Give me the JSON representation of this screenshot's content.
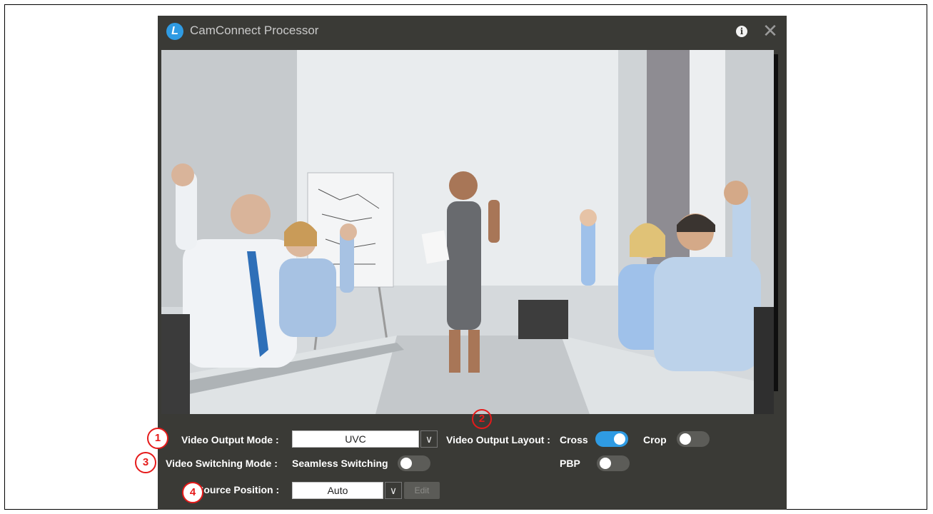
{
  "window": {
    "title": "CamConnect Processor",
    "logo_letter": "L",
    "icons": {
      "info": "info-icon",
      "close": "close-icon",
      "logo": "app-logo-icon"
    }
  },
  "controls": {
    "video_output_mode": {
      "label": "Video Output Mode :",
      "value": "UVC"
    },
    "video_output_layout": {
      "label": "Video Output Layout :",
      "options": [
        {
          "label": "Cross",
          "on": true
        },
        {
          "label": "Crop",
          "on": false
        },
        {
          "label": "PBP",
          "on": false
        }
      ]
    },
    "video_switching_mode": {
      "label": "Video Switching Mode :",
      "option_label": "Seamless Switching",
      "on": false
    },
    "source_position": {
      "label": "Source Position :",
      "value": "Auto",
      "edit_label": "Edit"
    }
  },
  "markers": [
    "1",
    "2",
    "3",
    "4"
  ],
  "colors": {
    "window_bg": "#3a3a36",
    "accent": "#2f9be3",
    "marker": "#e51a1a"
  }
}
